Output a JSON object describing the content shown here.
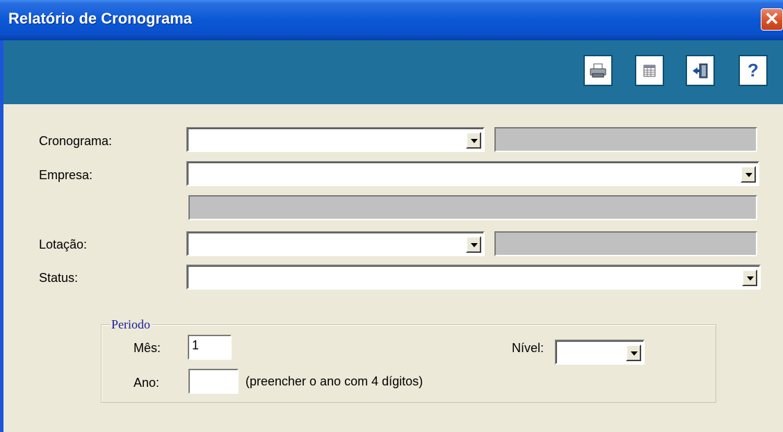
{
  "window": {
    "title": "Relatório de Cronograma",
    "close_label": "✕"
  },
  "toolbar": {
    "buttons": [
      {
        "name": "print-button",
        "icon": "printer-icon"
      },
      {
        "name": "report-button",
        "icon": "grid-icon"
      },
      {
        "name": "exit-button",
        "icon": "exit-door-icon"
      },
      {
        "name": "help-button",
        "label": "?",
        "icon": "help-icon"
      }
    ]
  },
  "form": {
    "cronograma_label": "Cronograma:",
    "empresa_label": "Empresa:",
    "lotacao_label": "Lotação:",
    "status_label": "Status:"
  },
  "periodo": {
    "legend": "Periodo",
    "mes_label": "Mês:",
    "mes_value": "1",
    "ano_label": "Ano:",
    "ano_value": "",
    "ano_hint": "(preencher o ano com 4 dígitos)",
    "nivel_label": "Nível:"
  }
}
